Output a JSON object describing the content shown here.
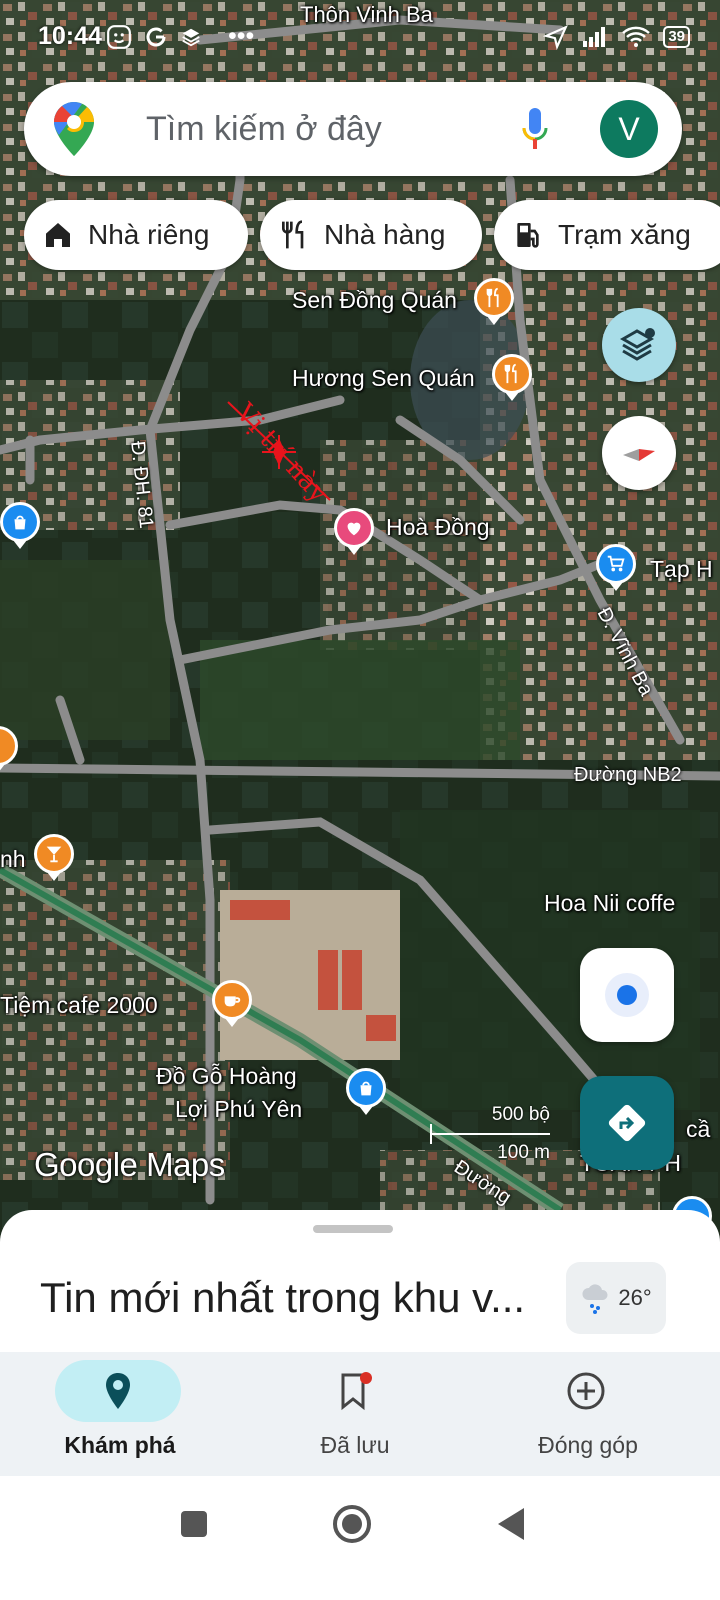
{
  "status_bar": {
    "time": "10:44",
    "battery": "39"
  },
  "search": {
    "placeholder": "Tìm kiếm ở đây",
    "avatar_letter": "V"
  },
  "chips": [
    {
      "label": "Nhà riêng",
      "icon": "home-icon"
    },
    {
      "label": "Nhà hàng",
      "icon": "restaurant-icon"
    },
    {
      "label": "Trạm xăng",
      "icon": "gas-station-icon"
    }
  ],
  "map": {
    "annotation": "Vị trí này",
    "places": {
      "thon_vinh_ba": "Thôn Vinh Ba",
      "sen_dong_quan": "Sen Đồng Quán",
      "huong_sen_quan": "Hương Sen Quán",
      "hoa_dong": "Hoà Đồng",
      "tap_hoa": "Tạp H",
      "hoa_nii": "Hoa Nii coffe",
      "tiem_cafe": "Tiệm cafe 2000",
      "do_go_line1": "Đồ Gỗ Hoàng",
      "do_go_line2": "Lợi Phú Yên",
      "ca": "cầ",
      "tuan_ph": "TUẤN PH",
      "nh": "nh"
    },
    "roads": {
      "dh81": "Đ. ĐH. 81",
      "vinh_ba": "Đ. Vĩnh Ba",
      "nb2": "Đường NB2",
      "duong": "Đường"
    },
    "scale_ft": "500 bộ",
    "scale_m": "100 m",
    "logo": "Google Maps"
  },
  "sheet": {
    "title": "Tin mới nhất trong khu v...",
    "weather": "26°"
  },
  "nav": [
    {
      "label": "Khám phá",
      "icon": "explore-pin-icon",
      "active": true
    },
    {
      "label": "Đã lưu",
      "icon": "bookmark-icon",
      "active": false
    },
    {
      "label": "Đóng góp",
      "icon": "add-circle-icon",
      "active": false
    }
  ],
  "colors": {
    "accent": "#0e6f7a",
    "active_nav_bg": "#c2eef4",
    "location_blue": "#1a73e8",
    "poi_orange": "#f08a24",
    "poi_blue": "#1a8cf0",
    "poi_pink": "#e84a7c",
    "annotation_red": "#e8141c"
  }
}
